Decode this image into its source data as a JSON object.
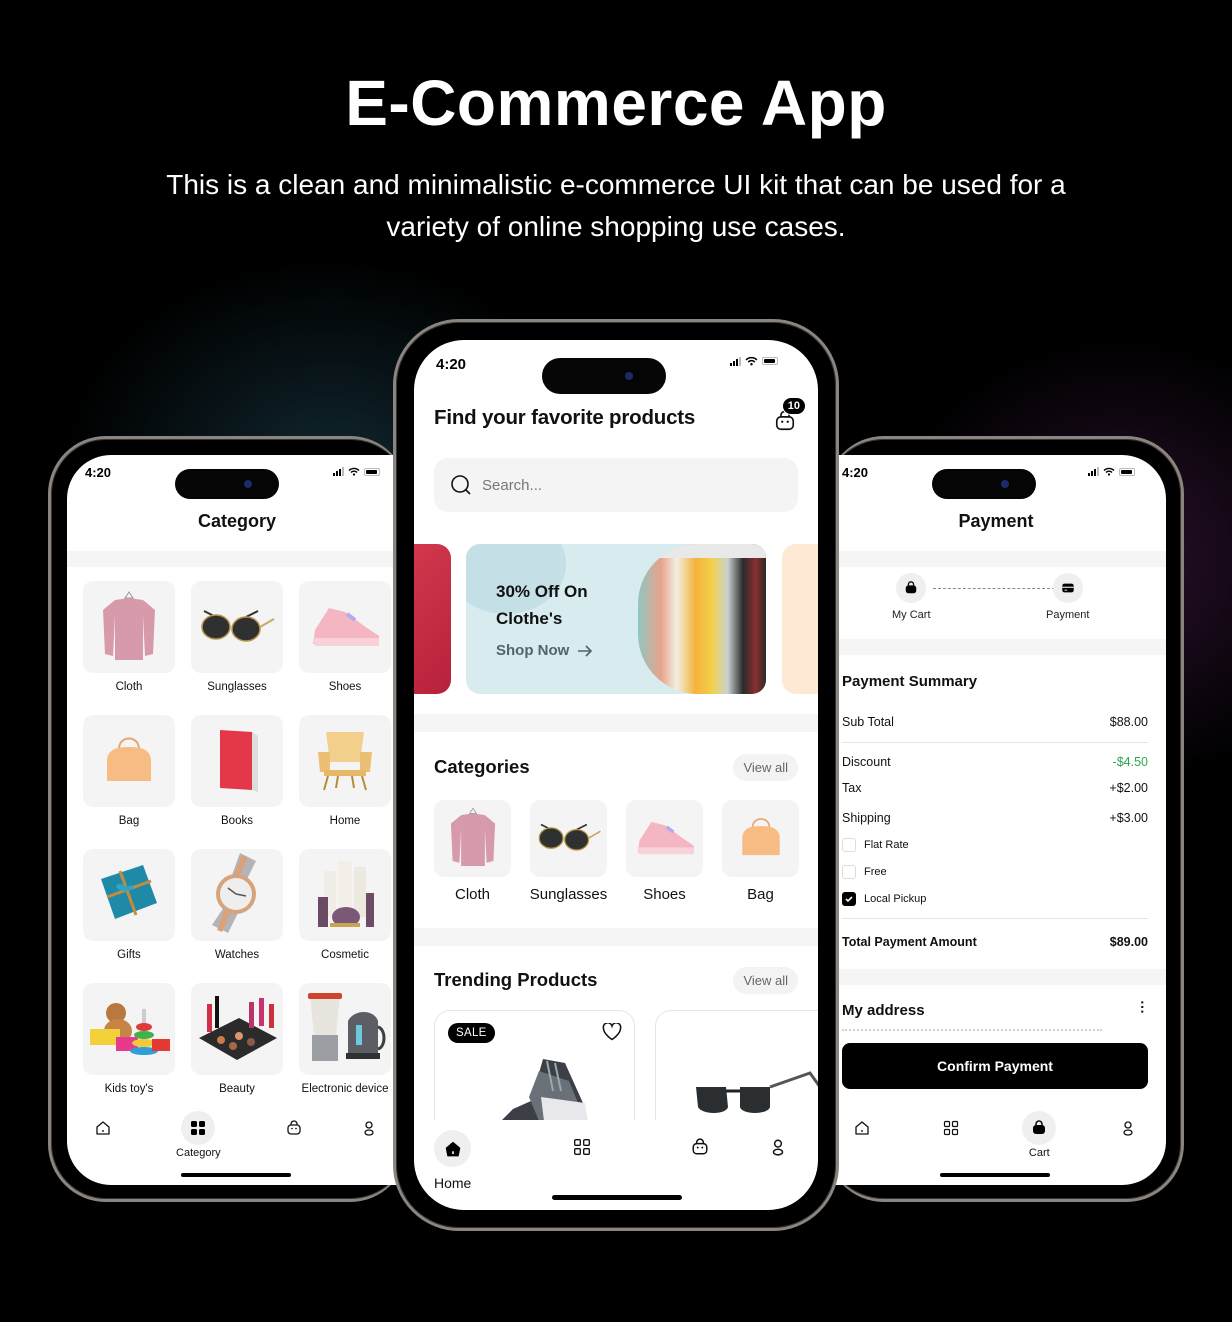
{
  "hero": {
    "title": "E-Commerce App",
    "subtitle": "This is a clean and minimalistic e-commerce UI kit that can be used for a variety of online shopping use cases."
  },
  "status_bar": {
    "time": "4:20"
  },
  "category_screen": {
    "title": "Category",
    "categories": [
      {
        "label": "Cloth",
        "icon": "sweater-image"
      },
      {
        "label": "Sunglasses",
        "icon": "sunglasses-image"
      },
      {
        "label": "Shoes",
        "icon": "sneaker-image"
      },
      {
        "label": "Bag",
        "icon": "handbag-image"
      },
      {
        "label": "Books",
        "icon": "book-image"
      },
      {
        "label": "Home",
        "icon": "armchair-image"
      },
      {
        "label": "Gifts",
        "icon": "gift-box-image"
      },
      {
        "label": "Watches",
        "icon": "watch-image"
      },
      {
        "label": "Cosmetic",
        "icon": "cosmetics-image"
      },
      {
        "label": "Kids toy's",
        "icon": "toys-image"
      },
      {
        "label": "Beauty",
        "icon": "makeup-image"
      },
      {
        "label": "Electronic device",
        "icon": "appliances-image"
      }
    ],
    "nav": {
      "active": "Category"
    }
  },
  "home_screen": {
    "title": "Find your favorite products",
    "cart_badge": "10",
    "search_placeholder": "Search...",
    "banner": {
      "line1": "30% Off On",
      "line2": "Clothe's",
      "cta": "Shop Now"
    },
    "categories_heading": "Categories",
    "view_all": "View all",
    "categories": [
      "Cloth",
      "Sunglasses",
      "Shoes",
      "Bag"
    ],
    "trending_heading": "Trending Products",
    "sale_badge": "SALE",
    "nav": {
      "active": "Home"
    }
  },
  "payment_screen": {
    "title": "Payment",
    "steps": [
      "My Cart",
      "Payment"
    ],
    "summary_title": "Payment Summary",
    "rows": {
      "subtotal": {
        "label": "Sub Total",
        "value": "$88.00"
      },
      "discount": {
        "label": "Discount",
        "value": "-$4.50"
      },
      "tax": {
        "label": "Tax",
        "value": "+$2.00"
      },
      "shipping": {
        "label": "Shipping",
        "value": "+$3.00"
      },
      "total": {
        "label": "Total Payment Amount",
        "value": "$89.00"
      }
    },
    "shipping_options": [
      {
        "label": "Flat Rate",
        "checked": false
      },
      {
        "label": "Free",
        "checked": false
      },
      {
        "label": "Local Pickup",
        "checked": true
      }
    ],
    "address_title": "My address",
    "confirm_label": "Confirm Payment",
    "nav": {
      "active": "Cart"
    }
  },
  "colors": {
    "discount": "#2fa84f",
    "accent": "#000000"
  }
}
